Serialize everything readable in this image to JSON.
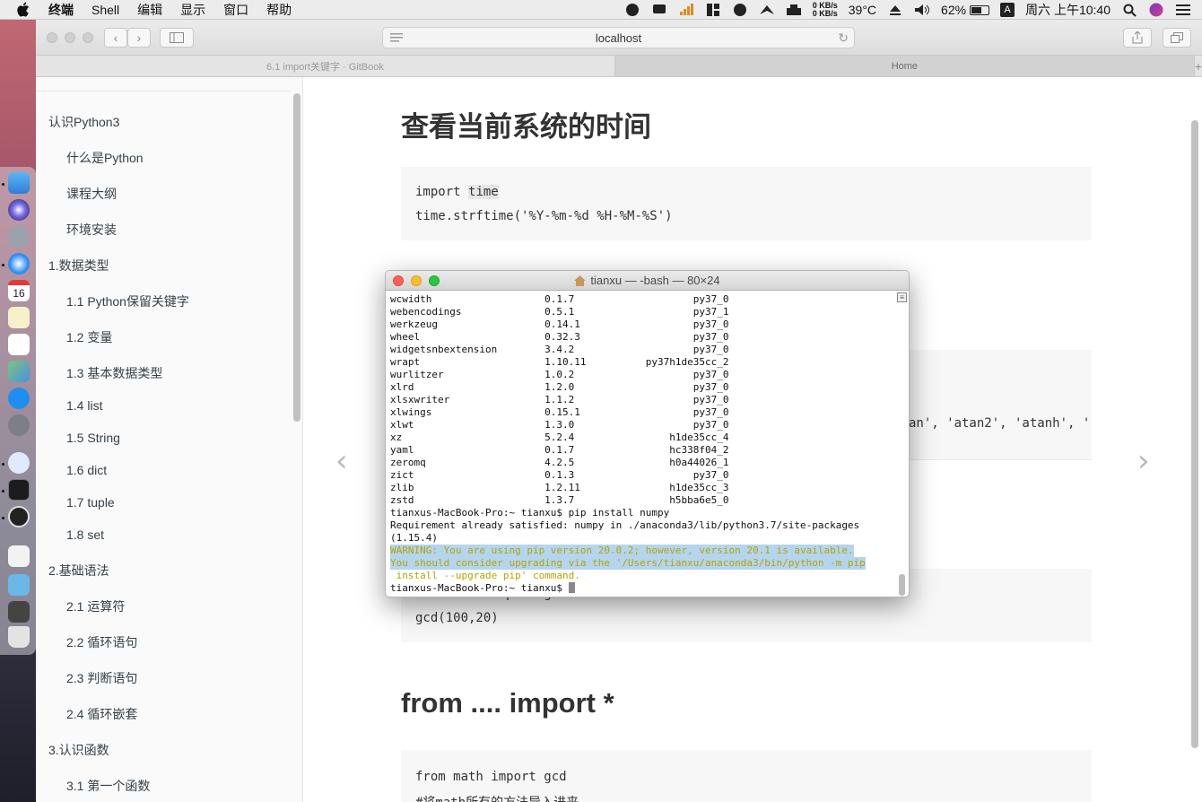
{
  "menubar": {
    "app_name": "终端",
    "items": [
      "Shell",
      "编辑",
      "显示",
      "窗口",
      "帮助"
    ],
    "temperature": "39°C",
    "net_up": "0 KB/s",
    "net_down": "0 KB/s",
    "battery_percent": "62%",
    "battery_level": 0.62,
    "input_method": "A",
    "clock": "周六 上午10:40"
  },
  "browser": {
    "address": "localhost",
    "tabs": [
      {
        "label": "6.1 import关键字 · GitBook",
        "active": true
      },
      {
        "label": "Home",
        "active": false
      }
    ]
  },
  "sidebar": {
    "items": [
      {
        "label": "认识Python3"
      },
      {
        "label": "什么是Python"
      },
      {
        "label": "课程大纲"
      },
      {
        "label": "环境安装"
      },
      {
        "label": "1.数据类型"
      },
      {
        "label": "1.1 Python保留关键字"
      },
      {
        "label": "1.2 变量"
      },
      {
        "label": "1.3 基本数据类型"
      },
      {
        "label": "1.4 list"
      },
      {
        "label": "1.5 String"
      },
      {
        "label": "1.6 dict"
      },
      {
        "label": "1.7 tuple"
      },
      {
        "label": "1.8 set"
      },
      {
        "label": "2.基础语法"
      },
      {
        "label": "2.1 运算符"
      },
      {
        "label": "2.2 循环语句"
      },
      {
        "label": "2.3 判断语句"
      },
      {
        "label": "2.4 循环嵌套"
      },
      {
        "label": "3.认识函数"
      },
      {
        "label": "3.1 第一个函数"
      }
    ]
  },
  "page": {
    "heading1": "查看当前系统的时间",
    "code1": {
      "line1_prefix": "import ",
      "line1_keyword": "time",
      "line2": "time.strftime('%Y-%m-%d %H-%M-%S')"
    },
    "partial_output": "an', 'atan2', 'atanh', '",
    "code3": {
      "line1": "from math import gcd",
      "line2": "gcd(100,20)"
    },
    "heading2": "from .... import *",
    "code4": {
      "line1": "from math import gcd",
      "line2": "#将math所有的方法导入进来"
    }
  },
  "terminal": {
    "title": "tianxu — -bash — 80×24",
    "lines": [
      "wcwidth                   0.1.7                    py37_0",
      "webencodings              0.5.1                    py37_1",
      "werkzeug                  0.14.1                   py37_0",
      "wheel                     0.32.3                   py37_0",
      "widgetsnbextension        3.4.2                    py37_0",
      "wrapt                     1.10.11          py37h1de35cc_2",
      "wurlitzer                 1.0.2                    py37_0",
      "xlrd                      1.2.0                    py37_0",
      "xlsxwriter                1.1.2                    py37_0",
      "xlwings                   0.15.1                   py37_0",
      "xlwt                      1.3.0                    py37_0",
      "xz                        5.2.4                h1de35cc_4",
      "yaml                      0.1.7                hc338f04_2",
      "zeromq                    4.2.5                h0a44026_1",
      "zict                      0.1.3                    py37_0",
      "zlib                      1.2.11               h1de35cc_3",
      "zstd                      1.3.7                h5bba6e5_0",
      "tianxus-MacBook-Pro:~ tianxu$ pip install numpy",
      "Requirement already satisfied: numpy in ./anaconda3/lib/python3.7/site-packages",
      "(1.15.4)",
      "WARNING: You are using pip version 20.0.2; however, version 20.1 is available.",
      "You should consider upgrading via the '/Users/tianxu/anaconda3/bin/python -m pip",
      " install --upgrade pip' command."
    ],
    "prompt": "tianxus-MacBook-Pro:~ tianxu$ "
  },
  "colors": {
    "warning_text": "#b4a400",
    "selection": "#b4d5f0",
    "sidebar_text": "#364149",
    "code_bg": "#f7f7f7"
  }
}
